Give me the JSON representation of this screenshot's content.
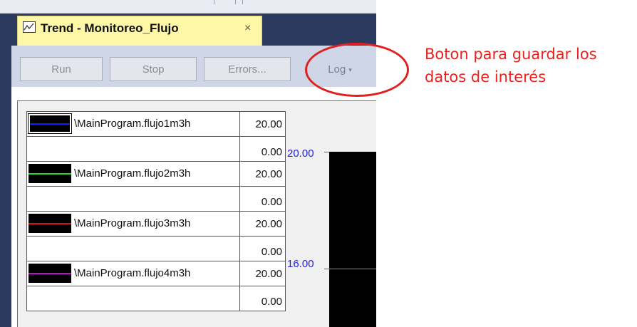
{
  "tab": {
    "title": "Trend - Monitoreo_Flujo",
    "close_glyph": "×",
    "icon": "trend-chart-icon",
    "background": "#fff7a8"
  },
  "toolbar": {
    "run_label": "Run",
    "stop_label": "Stop",
    "errors_label": "Errors...",
    "log_label": "Log",
    "log_caret": "▾"
  },
  "legend": {
    "rows": [
      {
        "tag": "\\MainProgram.flujo1m3h",
        "max": "20.00",
        "min": "0.00",
        "color": "#1a1aff",
        "selected": true
      },
      {
        "tag": "\\MainProgram.flujo2m3h",
        "max": "20.00",
        "min": "0.00",
        "color": "#22dd22",
        "selected": false
      },
      {
        "tag": "\\MainProgram.flujo3m3h",
        "max": "20.00",
        "min": "0.00",
        "color": "#e01010",
        "selected": false
      },
      {
        "tag": "\\MainProgram.flujo4m3h",
        "max": "20.00",
        "min": "0.00",
        "color": "#c010d0",
        "selected": false
      }
    ]
  },
  "axis": {
    "labels": [
      "20.00",
      "16.00"
    ],
    "color": "#2020e0"
  },
  "annotation": {
    "text": "Boton para guardar los datos de interés",
    "color": "#e8231f"
  }
}
